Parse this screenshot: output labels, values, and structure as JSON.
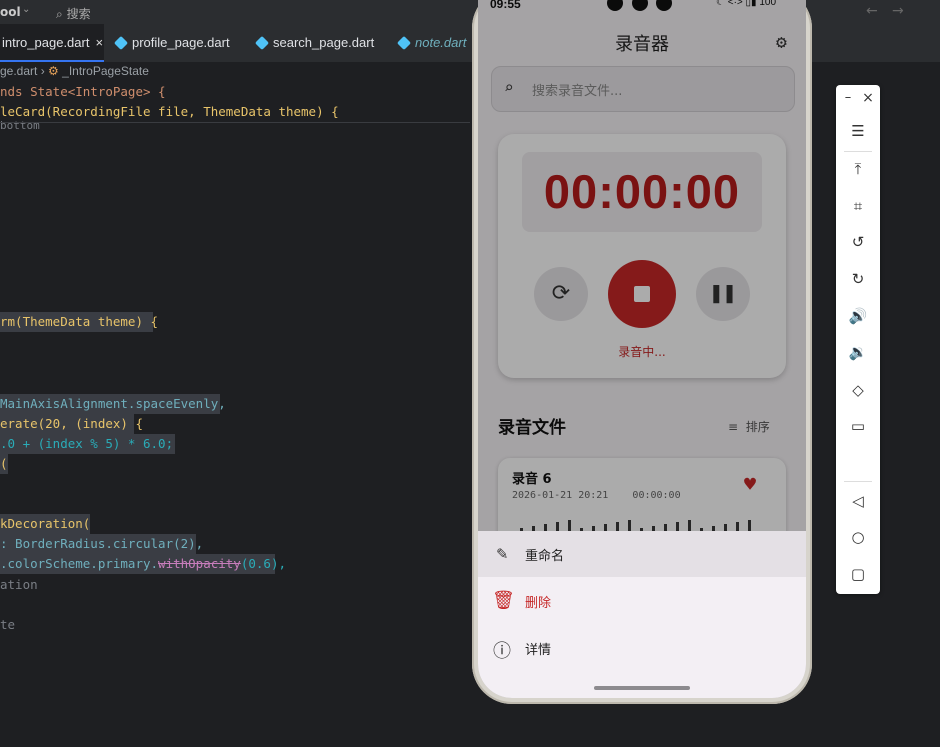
{
  "ide": {
    "project_name": "ool",
    "search_label": "搜索",
    "tabs": [
      {
        "label": "intro_page.dart",
        "active": true,
        "close": "×"
      },
      {
        "label": "profile_page.dart"
      },
      {
        "label": "search_page.dart"
      },
      {
        "label": "note.dart"
      }
    ],
    "breadcrumb": {
      "file": "ge.dart",
      "sep": "›",
      "symbol": "_IntroPageState"
    },
    "code_lines": {
      "l1": "nds State<IntroPage> {",
      "l2": "leCard(RecordingFile file, ThemeData theme) {",
      "l3": "bottom",
      "l4": "rm(ThemeData theme) {",
      "l5": "MainAxisAlignment.spaceEvenly,",
      "l6": "erate(20, (index) {",
      "l7": ".0 + (index % 5) * 6.0;",
      "l8": "(",
      "l9": "kDecoration(",
      "l10": ": BorderRadius.circular(2),",
      "l11a": ".colorScheme.primary.",
      "l11b": "withOpacity",
      "l11c": "(0.6),",
      "l12": "ation",
      "l13": "te"
    }
  },
  "phone": {
    "status": {
      "time": "09:55",
      "right": "☾ <·> ▯▮ 100"
    },
    "app_title": "录音器",
    "search_placeholder": "搜索录音文件...",
    "timer": "00:00:00",
    "recording_status": "录音中...",
    "section_title": "录音文件",
    "sort_label": "排序",
    "file": {
      "name": "录音 6",
      "date": "2026-01-21 20:21",
      "duration": "00:00:00"
    },
    "menu": [
      {
        "label": "重命名",
        "icon": "edit-icon"
      },
      {
        "label": "删除",
        "icon": "delete-icon"
      },
      {
        "label": "详情",
        "icon": "info-icon"
      }
    ],
    "accent_color": "#c62828"
  },
  "emulator_toolbar": {
    "minimize": "–",
    "close": "×"
  }
}
